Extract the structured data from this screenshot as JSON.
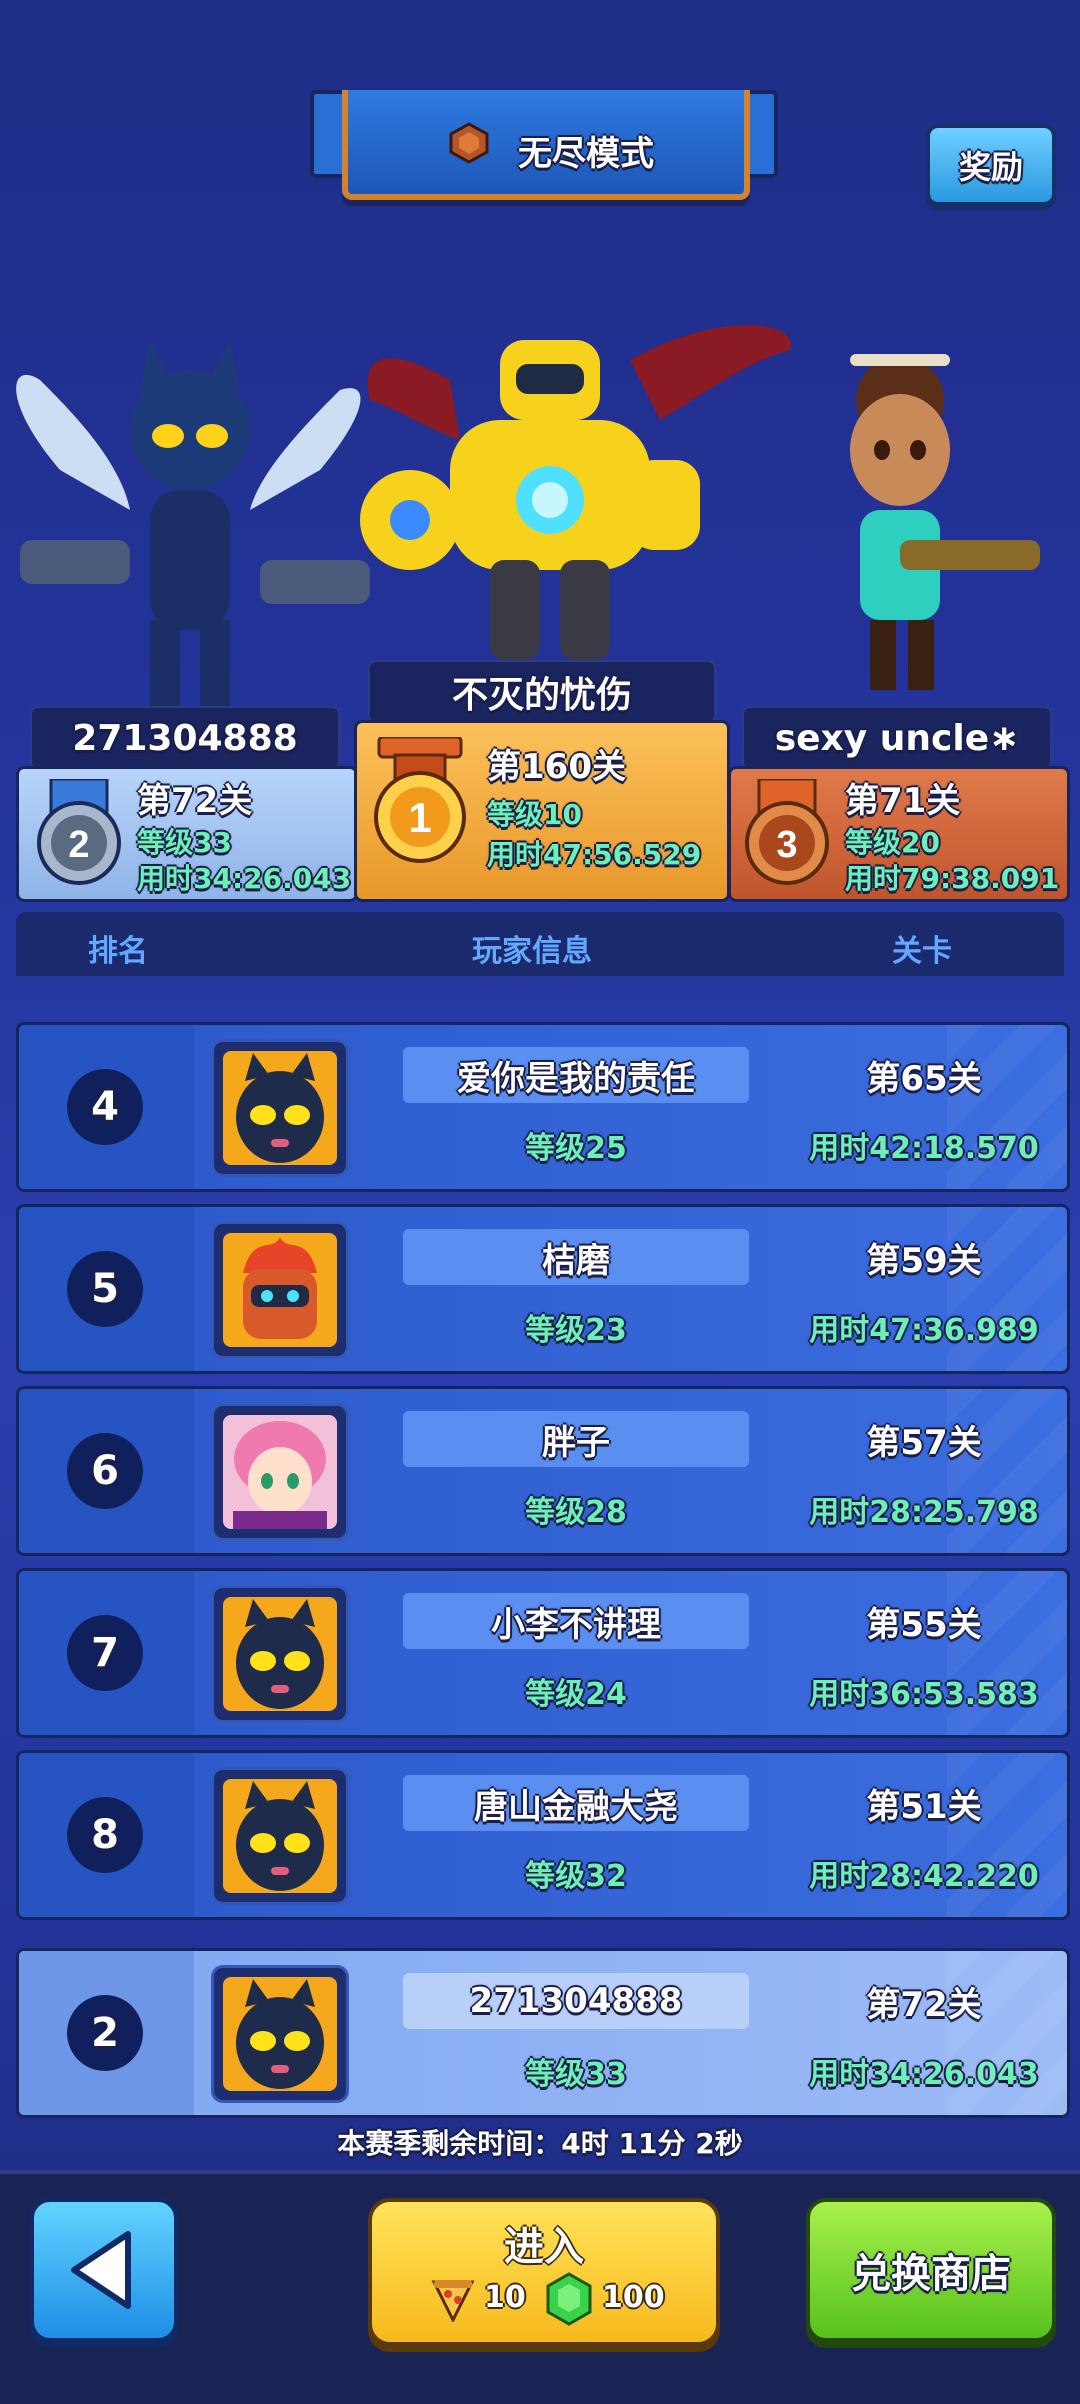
{
  "header": {
    "mode_title": "无尽模式",
    "reward_label": "奖励"
  },
  "podium": [
    {
      "rank": "2",
      "name": "271304888",
      "stage": "第72关",
      "level": "等级33",
      "time": "用时34:26.043"
    },
    {
      "rank": "1",
      "name": "不灭的忧伤",
      "stage": "第160关",
      "level": "等级10",
      "time": "用时47:56.529"
    },
    {
      "rank": "3",
      "name": "sexy uncle∗",
      "stage": "第71关",
      "level": "等级20",
      "time": "用时79:38.091"
    }
  ],
  "table": {
    "col_rank": "排名",
    "col_player": "玩家信息",
    "col_stage": "关卡",
    "rows": [
      {
        "rank": "4",
        "name": "爱你是我的责任",
        "level": "等级25",
        "stage": "第65关",
        "time": "用时42:18.570",
        "avatar": "black-cat-hero"
      },
      {
        "rank": "5",
        "name": "桔磨",
        "level": "等级23",
        "stage": "第59关",
        "time": "用时47:36.989",
        "avatar": "flame-robot-hero"
      },
      {
        "rank": "6",
        "name": "胖子",
        "level": "等级28",
        "stage": "第57关",
        "time": "用时28:25.798",
        "avatar": "pink-hair-hero"
      },
      {
        "rank": "7",
        "name": "小李不讲理",
        "level": "等级24",
        "stage": "第55关",
        "time": "用时36:53.583",
        "avatar": "black-cat-hero"
      },
      {
        "rank": "8",
        "name": "唐山金融大尧",
        "level": "等级32",
        "stage": "第51关",
        "time": "用时28:42.220",
        "avatar": "black-cat-hero"
      }
    ],
    "my_row": {
      "rank": "2",
      "name": "271304888",
      "level": "等级33",
      "stage": "第72关",
      "time": "用时34:26.043",
      "avatar": "black-cat-hero"
    }
  },
  "season_timer": "本赛季剩余时间：4时 11分 2秒",
  "bottom": {
    "enter_label": "进入",
    "cost_pizza": "10",
    "cost_gem": "100",
    "shop_label": "兑换商店"
  },
  "colors": {
    "gold": "#f2a93a",
    "silver": "#8fb4e8",
    "bronze": "#c9643a",
    "level_text": "#6cf0b8"
  }
}
